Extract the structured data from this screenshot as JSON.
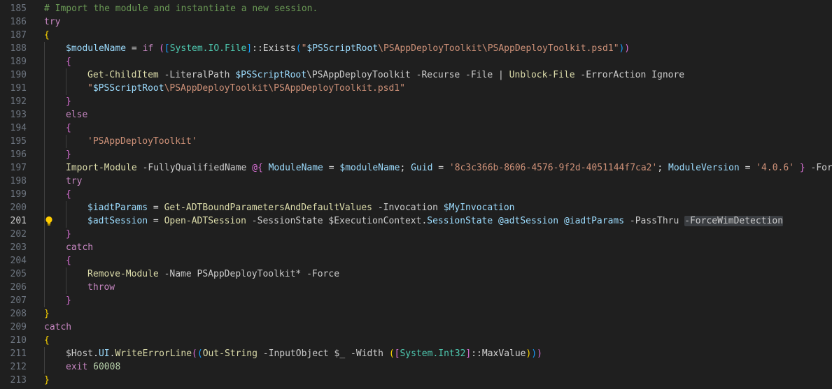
{
  "active_line": "201",
  "lines": [
    {
      "number": "185",
      "tokens": [
        {
          "t": "# Import the module and instantiate a new session.",
          "c": "comment"
        }
      ]
    },
    {
      "number": "186",
      "tokens": [
        {
          "t": "try",
          "c": "ctrl"
        }
      ]
    },
    {
      "number": "187",
      "tokens": [
        {
          "t": "{",
          "c": "b1"
        }
      ]
    },
    {
      "number": "188",
      "indent": 1,
      "tokens": [
        {
          "t": "$moduleName",
          "c": "var"
        },
        {
          "t": " = ",
          "c": "op"
        },
        {
          "t": "if",
          "c": "ctrl"
        },
        {
          "t": " ",
          "c": "op"
        },
        {
          "t": "(",
          "c": "b2"
        },
        {
          "t": "[",
          "c": "b3"
        },
        {
          "t": "System.IO.File",
          "c": "type"
        },
        {
          "t": "]",
          "c": "b3"
        },
        {
          "t": "::",
          "c": "op"
        },
        {
          "t": "Exists",
          "c": "op"
        },
        {
          "t": "(",
          "c": "b3"
        },
        {
          "t": "\"",
          "c": "str"
        },
        {
          "t": "$PSScriptRoot",
          "c": "var"
        },
        {
          "t": "\\PSAppDeployToolkit\\PSAppDeployToolkit.psd1\"",
          "c": "str"
        },
        {
          "t": ")",
          "c": "b3"
        },
        {
          "t": ")",
          "c": "b2"
        }
      ]
    },
    {
      "number": "189",
      "indent": 1,
      "tokens": [
        {
          "t": "{",
          "c": "b2"
        }
      ]
    },
    {
      "number": "190",
      "indent": 2,
      "tokens": [
        {
          "t": "Get-ChildItem",
          "c": "cmd"
        },
        {
          "t": " -LiteralPath ",
          "c": "param"
        },
        {
          "t": "$PSScriptRoot",
          "c": "var"
        },
        {
          "t": "\\PSAppDeployToolkit -Recurse -File ",
          "c": "param"
        },
        {
          "t": "|",
          "c": "op"
        },
        {
          "t": " ",
          "c": "op"
        },
        {
          "t": "Unblock-File",
          "c": "cmd"
        },
        {
          "t": " -ErrorAction Ignore",
          "c": "param"
        }
      ]
    },
    {
      "number": "191",
      "indent": 2,
      "tokens": [
        {
          "t": "\"",
          "c": "str"
        },
        {
          "t": "$PSScriptRoot",
          "c": "var"
        },
        {
          "t": "\\PSAppDeployToolkit\\PSAppDeployToolkit.psd1\"",
          "c": "str"
        }
      ]
    },
    {
      "number": "192",
      "indent": 1,
      "tokens": [
        {
          "t": "}",
          "c": "b2"
        }
      ]
    },
    {
      "number": "193",
      "indent": 1,
      "tokens": [
        {
          "t": "else",
          "c": "ctrl"
        }
      ]
    },
    {
      "number": "194",
      "indent": 1,
      "tokens": [
        {
          "t": "{",
          "c": "b2"
        }
      ]
    },
    {
      "number": "195",
      "indent": 2,
      "tokens": [
        {
          "t": "'PSAppDeployToolkit'",
          "c": "str"
        }
      ]
    },
    {
      "number": "196",
      "indent": 1,
      "tokens": [
        {
          "t": "}",
          "c": "b2"
        }
      ]
    },
    {
      "number": "197",
      "indent": 1,
      "tokens": [
        {
          "t": "Import-Module",
          "c": "cmd"
        },
        {
          "t": " -FullyQualifiedName ",
          "c": "param"
        },
        {
          "t": "@{",
          "c": "b2"
        },
        {
          "t": " ",
          "c": "op"
        },
        {
          "t": "ModuleName",
          "c": "var"
        },
        {
          "t": " = ",
          "c": "op"
        },
        {
          "t": "$moduleName",
          "c": "var"
        },
        {
          "t": "; ",
          "c": "op"
        },
        {
          "t": "Guid",
          "c": "var"
        },
        {
          "t": " = ",
          "c": "op"
        },
        {
          "t": "'8c3c366b-8606-4576-9f2d-4051144f7ca2'",
          "c": "str"
        },
        {
          "t": "; ",
          "c": "op"
        },
        {
          "t": "ModuleVersion",
          "c": "var"
        },
        {
          "t": " = ",
          "c": "op"
        },
        {
          "t": "'4.0.6'",
          "c": "str"
        },
        {
          "t": " ",
          "c": "op"
        },
        {
          "t": "}",
          "c": "b2"
        },
        {
          "t": " -Force",
          "c": "param"
        }
      ]
    },
    {
      "number": "198",
      "indent": 1,
      "tokens": [
        {
          "t": "try",
          "c": "ctrl"
        }
      ]
    },
    {
      "number": "199",
      "indent": 1,
      "tokens": [
        {
          "t": "{",
          "c": "b2"
        }
      ]
    },
    {
      "number": "200",
      "indent": 2,
      "tokens": [
        {
          "t": "$iadtParams",
          "c": "var"
        },
        {
          "t": " = ",
          "c": "op"
        },
        {
          "t": "Get-ADTBoundParametersAndDefaultValues",
          "c": "cmd"
        },
        {
          "t": " -Invocation ",
          "c": "param"
        },
        {
          "t": "$MyInvocation",
          "c": "var"
        }
      ]
    },
    {
      "number": "201",
      "indent": 2,
      "bulb": true,
      "tokens": [
        {
          "t": "$adtSession",
          "c": "var"
        },
        {
          "t": " = ",
          "c": "op"
        },
        {
          "t": "Open-ADTSession",
          "c": "cmd"
        },
        {
          "t": " -SessionState ",
          "c": "param"
        },
        {
          "t": "$ExecutionContext",
          "c": "param"
        },
        {
          "t": ".",
          "c": "op"
        },
        {
          "t": "SessionState",
          "c": "var"
        },
        {
          "t": " ",
          "c": "op"
        },
        {
          "t": "@adtSession",
          "c": "var"
        },
        {
          "t": " ",
          "c": "op"
        },
        {
          "t": "@iadtParams",
          "c": "var"
        },
        {
          "t": " -PassThru ",
          "c": "param"
        },
        {
          "t": "-ForceWimDetection",
          "c": "param",
          "hl": true
        }
      ]
    },
    {
      "number": "202",
      "indent": 1,
      "tokens": [
        {
          "t": "}",
          "c": "b2"
        }
      ]
    },
    {
      "number": "203",
      "indent": 1,
      "tokens": [
        {
          "t": "catch",
          "c": "ctrl"
        }
      ]
    },
    {
      "number": "204",
      "indent": 1,
      "tokens": [
        {
          "t": "{",
          "c": "b2"
        }
      ]
    },
    {
      "number": "205",
      "indent": 2,
      "tokens": [
        {
          "t": "Remove-Module",
          "c": "cmd"
        },
        {
          "t": " -Name PSAppDeployToolkit* -Force",
          "c": "param"
        }
      ]
    },
    {
      "number": "206",
      "indent": 2,
      "tokens": [
        {
          "t": "throw",
          "c": "ctrl"
        }
      ]
    },
    {
      "number": "207",
      "indent": 1,
      "tokens": [
        {
          "t": "}",
          "c": "b2"
        }
      ]
    },
    {
      "number": "208",
      "tokens": [
        {
          "t": "}",
          "c": "b1"
        }
      ]
    },
    {
      "number": "209",
      "tokens": [
        {
          "t": "catch",
          "c": "ctrl"
        }
      ]
    },
    {
      "number": "210",
      "tokens": [
        {
          "t": "{",
          "c": "b1"
        }
      ]
    },
    {
      "number": "211",
      "indent": 1,
      "tokens": [
        {
          "t": "$Host",
          "c": "param"
        },
        {
          "t": ".",
          "c": "op"
        },
        {
          "t": "UI",
          "c": "var"
        },
        {
          "t": ".",
          "c": "op"
        },
        {
          "t": "WriteErrorLine",
          "c": "cmd"
        },
        {
          "t": "(",
          "c": "b2"
        },
        {
          "t": "(",
          "c": "b3"
        },
        {
          "t": "Out-String",
          "c": "cmd"
        },
        {
          "t": " -InputObject ",
          "c": "param"
        },
        {
          "t": "$_",
          "c": "param"
        },
        {
          "t": " -Width ",
          "c": "param"
        },
        {
          "t": "(",
          "c": "b1"
        },
        {
          "t": "[",
          "c": "b2"
        },
        {
          "t": "System.Int32",
          "c": "type"
        },
        {
          "t": "]",
          "c": "b2"
        },
        {
          "t": "::",
          "c": "op"
        },
        {
          "t": "MaxValue",
          "c": "op"
        },
        {
          "t": ")",
          "c": "b1"
        },
        {
          "t": ")",
          "c": "b3"
        },
        {
          "t": ")",
          "c": "b2"
        }
      ]
    },
    {
      "number": "212",
      "indent": 1,
      "tokens": [
        {
          "t": "exit",
          "c": "ctrl"
        },
        {
          "t": " 60008",
          "c": "num"
        }
      ]
    },
    {
      "number": "213",
      "tokens": [
        {
          "t": "}",
          "c": "b1"
        }
      ]
    }
  ]
}
